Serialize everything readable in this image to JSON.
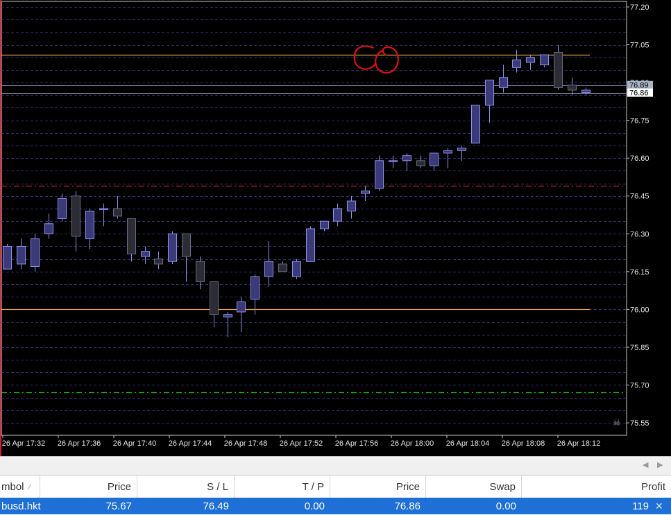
{
  "chart": {
    "price_scale": [
      "77.20",
      "77.05",
      "76.90",
      "76.75",
      "76.60",
      "76.45",
      "76.30",
      "76.15",
      "76.00",
      "75.85",
      "75.70",
      "75.55"
    ],
    "time_labels": [
      "26 Apr 17:32",
      "26 Apr 17:36",
      "26 Apr 17:40",
      "26 Apr 17:44",
      "26 Apr 17:48",
      "26 Apr 17:52",
      "26 Apr 17:56",
      "26 Apr 18:00",
      "26 Apr 18:04",
      "26 Apr 18:08",
      "26 Apr 18:12"
    ],
    "current_price_labels": [
      "76.89",
      "76.86"
    ],
    "annotation_text": "GO",
    "levels": [
      {
        "price": 77.01,
        "color": "#e8a43a",
        "style": "solid",
        "extends": "chart"
      },
      {
        "price": 76.49,
        "color": "#d82020",
        "style": "dashdot",
        "extends": "full"
      },
      {
        "price": 76.0,
        "color": "#e8a43a",
        "style": "solid",
        "extends": "chart"
      },
      {
        "price": 75.67,
        "color": "#22c422",
        "style": "dashdot",
        "extends": "full"
      }
    ],
    "colors": {
      "bull": "#3a3a78",
      "bull_border": "#8f8ff0",
      "bear": "#2c2c34",
      "bear_border": "#6a6a88",
      "wick": "#8f8ff0",
      "grid": "#2e2e78",
      "text": "#e8e8e8",
      "annotation": "#e01010"
    }
  },
  "chart_data": {
    "type": "candlestick",
    "ylim": [
      75.52,
      77.2
    ],
    "candles": [
      {
        "o": 76.16,
        "h": 76.26,
        "l": 76.16,
        "c": 76.25
      },
      {
        "o": 76.18,
        "h": 76.28,
        "l": 76.16,
        "c": 76.25
      },
      {
        "o": 76.17,
        "h": 76.3,
        "l": 76.15,
        "c": 76.28
      },
      {
        "o": 76.3,
        "h": 76.38,
        "l": 76.28,
        "c": 76.34
      },
      {
        "o": 76.36,
        "h": 76.46,
        "l": 76.35,
        "c": 76.44
      },
      {
        "o": 76.45,
        "h": 76.47,
        "l": 76.23,
        "c": 76.29
      },
      {
        "o": 76.28,
        "h": 76.4,
        "l": 76.24,
        "c": 76.39
      },
      {
        "o": 76.4,
        "h": 76.42,
        "l": 76.33,
        "c": 76.4
      },
      {
        "o": 76.4,
        "h": 76.45,
        "l": 76.36,
        "c": 76.37
      },
      {
        "o": 76.36,
        "h": 76.36,
        "l": 76.19,
        "c": 76.22
      },
      {
        "o": 76.21,
        "h": 76.25,
        "l": 76.18,
        "c": 76.23
      },
      {
        "o": 76.2,
        "h": 76.23,
        "l": 76.16,
        "c": 76.18
      },
      {
        "o": 76.19,
        "h": 76.31,
        "l": 76.18,
        "c": 76.3
      },
      {
        "o": 76.3,
        "h": 76.3,
        "l": 76.11,
        "c": 76.21
      },
      {
        "o": 76.19,
        "h": 76.21,
        "l": 76.08,
        "c": 76.11
      },
      {
        "o": 76.11,
        "h": 76.11,
        "l": 75.93,
        "c": 75.98
      },
      {
        "o": 75.97,
        "h": 75.99,
        "l": 75.89,
        "c": 75.98
      },
      {
        "o": 75.99,
        "h": 76.05,
        "l": 75.91,
        "c": 76.03
      },
      {
        "o": 76.04,
        "h": 76.14,
        "l": 75.98,
        "c": 76.13
      },
      {
        "o": 76.13,
        "h": 76.27,
        "l": 76.09,
        "c": 76.19
      },
      {
        "o": 76.18,
        "h": 76.19,
        "l": 76.15,
        "c": 76.15
      },
      {
        "o": 76.13,
        "h": 76.2,
        "l": 76.12,
        "c": 76.19
      },
      {
        "o": 76.19,
        "h": 76.33,
        "l": 76.19,
        "c": 76.32
      },
      {
        "o": 76.32,
        "h": 76.35,
        "l": 76.31,
        "c": 76.35
      },
      {
        "o": 76.35,
        "h": 76.42,
        "l": 76.33,
        "c": 76.4
      },
      {
        "o": 76.39,
        "h": 76.45,
        "l": 76.36,
        "c": 76.43
      },
      {
        "o": 76.46,
        "h": 76.49,
        "l": 76.43,
        "c": 76.47
      },
      {
        "o": 76.48,
        "h": 76.61,
        "l": 76.47,
        "c": 76.59
      },
      {
        "o": 76.59,
        "h": 76.61,
        "l": 76.56,
        "c": 76.59
      },
      {
        "o": 76.59,
        "h": 76.62,
        "l": 76.55,
        "c": 76.61
      },
      {
        "o": 76.59,
        "h": 76.61,
        "l": 76.56,
        "c": 76.57
      },
      {
        "o": 76.57,
        "h": 76.62,
        "l": 76.55,
        "c": 76.62
      },
      {
        "o": 76.62,
        "h": 76.64,
        "l": 76.56,
        "c": 76.63
      },
      {
        "o": 76.63,
        "h": 76.65,
        "l": 76.59,
        "c": 76.64
      },
      {
        "o": 76.66,
        "h": 76.81,
        "l": 76.66,
        "c": 76.81
      },
      {
        "o": 76.81,
        "h": 76.91,
        "l": 76.74,
        "c": 76.91
      },
      {
        "o": 76.88,
        "h": 76.97,
        "l": 76.86,
        "c": 76.92
      },
      {
        "o": 76.96,
        "h": 77.03,
        "l": 76.94,
        "c": 76.99
      },
      {
        "o": 76.98,
        "h": 77.01,
        "l": 76.95,
        "c": 77.0
      },
      {
        "o": 76.97,
        "h": 77.01,
        "l": 76.96,
        "c": 77.01
      },
      {
        "o": 77.02,
        "h": 77.05,
        "l": 76.87,
        "c": 76.88
      },
      {
        "o": 76.89,
        "h": 76.92,
        "l": 76.85,
        "c": 76.87
      },
      {
        "o": 76.86,
        "h": 76.88,
        "l": 76.85,
        "c": 76.87
      }
    ]
  },
  "table": {
    "headers": {
      "symbol": "mbol",
      "price": "Price",
      "sl": "S / L",
      "tp": "T / P",
      "price2": "Price",
      "swap": "Swap",
      "profit": "Profit"
    },
    "row": {
      "symbol": "busd.hkt",
      "price": "75.67",
      "sl": "76.49",
      "tp": "0.00",
      "price2": "76.86",
      "swap": "0.00",
      "profit": "119"
    }
  }
}
